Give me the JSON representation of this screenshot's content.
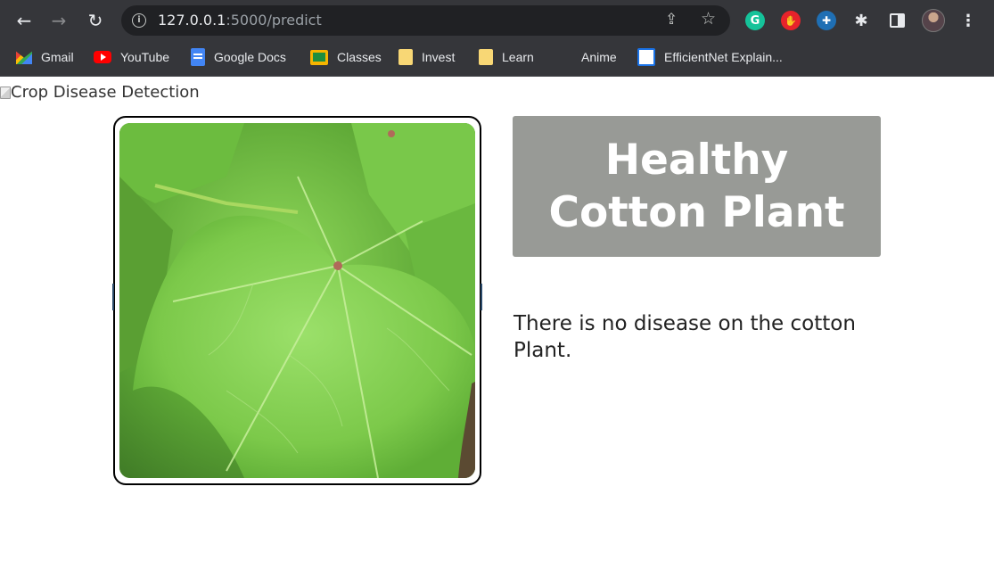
{
  "browser": {
    "url_host": "127.0.0.1",
    "url_path": ":5000/predict",
    "nav": {
      "back_icon": "arrow-left-icon",
      "forward_icon": "arrow-right-icon",
      "reload_icon": "reload-icon"
    },
    "extensions": [
      {
        "name": "grammarly-icon",
        "glyph": "G"
      },
      {
        "name": "adblock-icon",
        "glyph": "✋"
      },
      {
        "name": "eyedropper-icon",
        "glyph": "✚"
      }
    ]
  },
  "bookmarks": [
    {
      "label": "Gmail",
      "icon": "gmail-icon"
    },
    {
      "label": "YouTube",
      "icon": "youtube-icon"
    },
    {
      "label": "Google Docs",
      "icon": "google-docs-icon"
    },
    {
      "label": "Classes",
      "icon": "google-classroom-icon"
    },
    {
      "label": "Invest",
      "icon": "folder-icon"
    },
    {
      "label": "Learn",
      "icon": "folder-icon"
    },
    {
      "label": "Anime",
      "icon": "bookmark-icon"
    },
    {
      "label": "EfficientNet Explain...",
      "icon": "efficientnet-icon"
    }
  ],
  "page": {
    "logo_alt": "Crop Disease Detection",
    "result_title": "Healthy Cotton Plant",
    "result_description": "There is no disease on the cotton Plant.",
    "colors": {
      "banner_bg": "#989a96",
      "banner_text": "#ffffff",
      "frame_border": "#000000"
    }
  }
}
